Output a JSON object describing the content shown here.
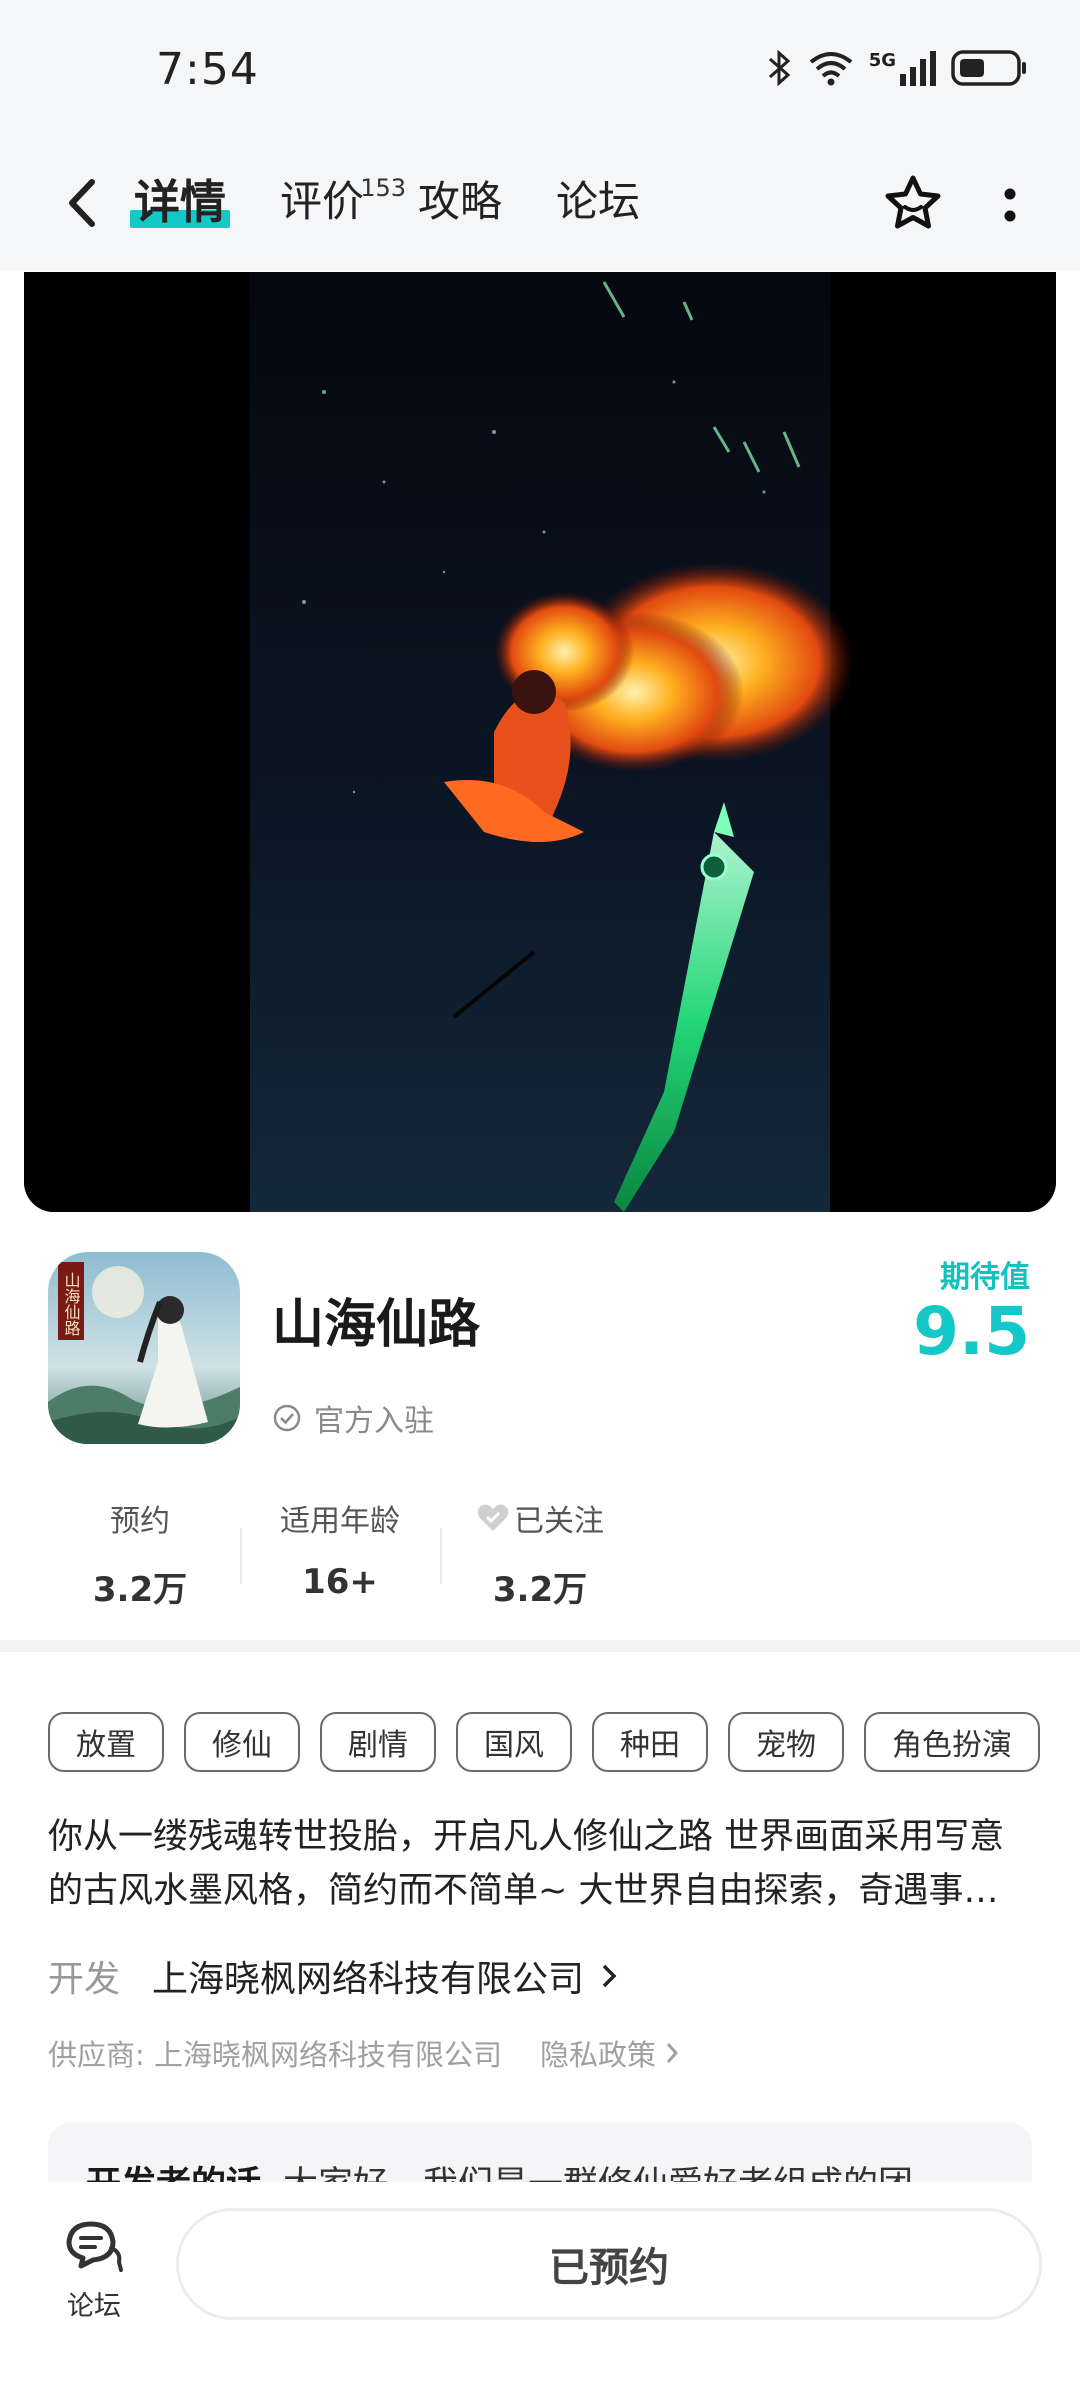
{
  "status": {
    "time": "7:54",
    "network": "5G"
  },
  "nav": {
    "tabs": [
      {
        "label": "详情",
        "active": true
      },
      {
        "label": "评价",
        "badge": "153"
      },
      {
        "label": "攻略"
      },
      {
        "label": "论坛"
      }
    ],
    "icons": [
      "back-arrow-icon",
      "star-icon",
      "more-vertical-icon"
    ]
  },
  "app": {
    "name": "山海仙路",
    "official_label": "官方入驻",
    "icon_text": "山海仙路",
    "expectation_label": "期待值",
    "expectation_score": "9.5"
  },
  "stats": [
    {
      "label": "预约",
      "value": "3.2万"
    },
    {
      "label": "适用年龄",
      "value": "16+"
    },
    {
      "label": "已关注",
      "value": "3.2万"
    }
  ],
  "tags": [
    "放置",
    "修仙",
    "剧情",
    "国风",
    "种田",
    "宠物",
    "角色扮演"
  ],
  "description": {
    "line1": "你从一缕残魂转世投胎，开启凡人修仙之路 世界画面采用写意",
    "line2": "的古风水墨风格，简约而不简单~ 大世界自由探索，奇遇事…"
  },
  "developer": {
    "label": "开发",
    "name": "上海晓枫网络科技有限公司",
    "supplier": "供应商: 上海晓枫网络科技有限公司",
    "privacy": "隐私政策"
  },
  "dev_words": {
    "title": "开发者的话",
    "text": "大家好，我们是一群修仙爱好者组成的团"
  },
  "bottom": {
    "forum_label": "论坛",
    "reserve_label": "已预约"
  },
  "colors": {
    "accent": "#14c8c8",
    "text": "#222222",
    "muted": "#8a8a8a"
  }
}
